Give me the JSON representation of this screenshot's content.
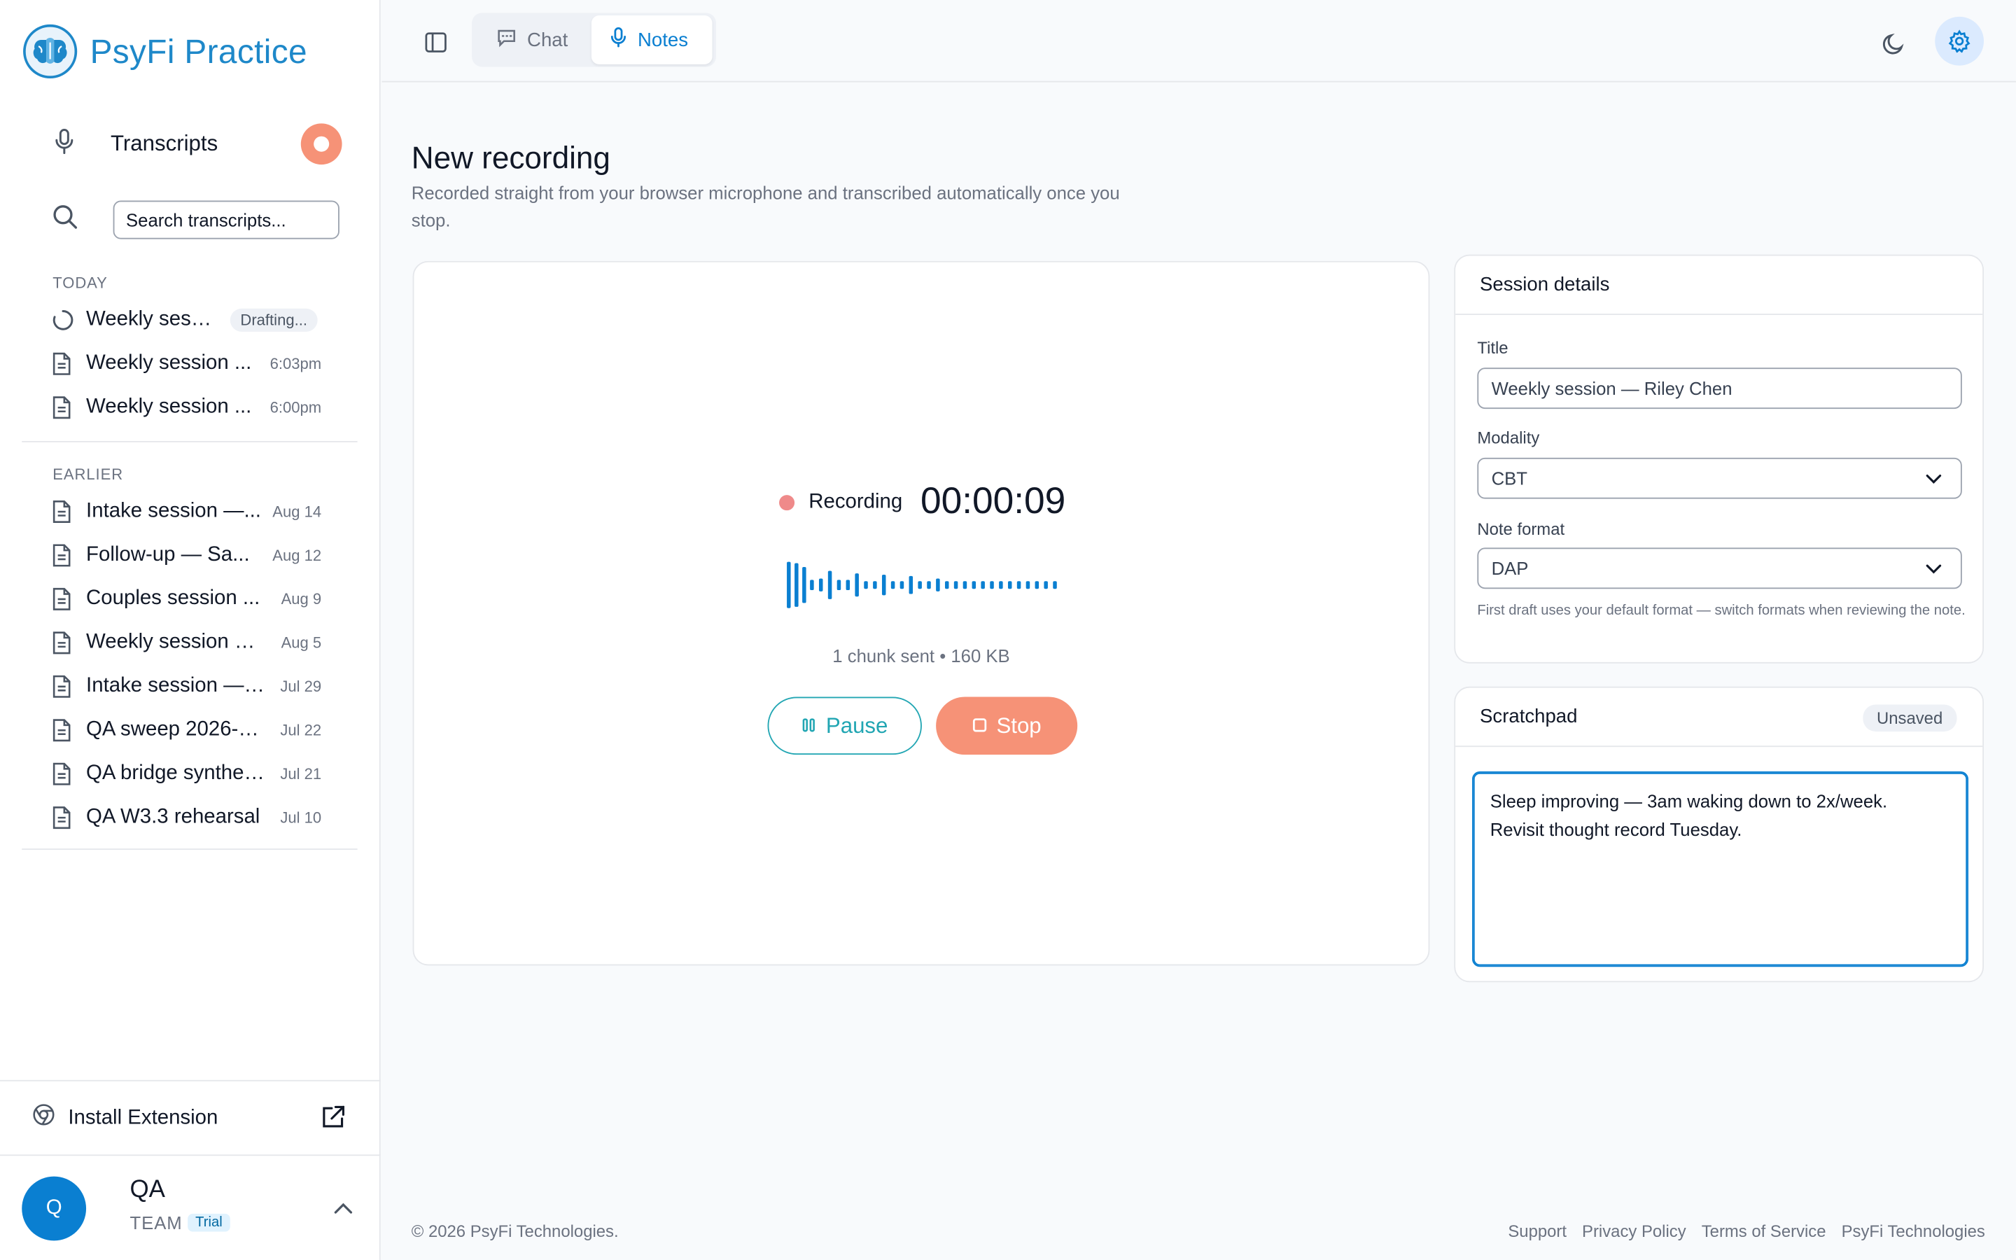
{
  "brand": {
    "name": "PsyFi Practice"
  },
  "sidebar": {
    "transcripts_label": "Transcripts",
    "search_placeholder": "Search transcripts...",
    "today_label": "TODAY",
    "earlier_label": "EARLIER",
    "today_items": [
      {
        "title": "Weekly sessi...",
        "status": "Drafting..."
      },
      {
        "title": "Weekly session ...",
        "time": "6:03pm"
      },
      {
        "title": "Weekly session ...",
        "time": "6:00pm"
      }
    ],
    "earlier_items": [
      {
        "title": "Intake session —...",
        "time": "Aug 14"
      },
      {
        "title": "Follow-up — Sa...",
        "time": "Aug 12"
      },
      {
        "title": "Couples session ...",
        "time": "Aug 9"
      },
      {
        "title": "Weekly session —...",
        "time": "Aug 5"
      },
      {
        "title": "Intake session — J...",
        "time": "Jul 29"
      },
      {
        "title": "QA sweep 2026-0...",
        "time": "Jul 22"
      },
      {
        "title": "QA bridge synthet...",
        "time": "Jul 21"
      },
      {
        "title": "QA W3.3 rehearsal",
        "time": "Jul 10"
      }
    ],
    "install_label": "Install Extension",
    "user": {
      "initial": "Q",
      "name": "QA",
      "team": "TEAM",
      "plan": "Trial"
    }
  },
  "topbar": {
    "tabs": [
      {
        "label": "Chat"
      },
      {
        "label": "Notes"
      }
    ]
  },
  "main": {
    "title": "New recording",
    "subtitle": "Recorded straight from your browser microphone and transcribed automatically once you stop.",
    "recorder": {
      "status": "Recording",
      "timer": "00:00:09",
      "chunk_info": "1 chunk sent • 160 KB",
      "pause_label": "Pause",
      "stop_label": "Stop"
    }
  },
  "details": {
    "header": "Session details",
    "title_label": "Title",
    "title_value": "Weekly session — Riley Chen",
    "modality_label": "Modality",
    "modality_value": "CBT",
    "format_label": "Note format",
    "format_value": "DAP",
    "helper": "First draft uses your default format — switch formats when reviewing the note."
  },
  "scratchpad": {
    "header": "Scratchpad",
    "status": "Unsaved",
    "text": "Sleep improving — 3am waking down to 2x/week.\nRevisit thought record Tuesday."
  },
  "footer": {
    "copyright": "© 2026 PsyFi Technologies.",
    "links": [
      "Support",
      "Privacy Policy",
      "Terms of Service",
      "PsyFi Technologies"
    ]
  },
  "colors": {
    "accent": "#0a7fd1",
    "stop": "#f69277",
    "pause": "#22a6b3",
    "rec_dot": "#ef8a8a"
  }
}
